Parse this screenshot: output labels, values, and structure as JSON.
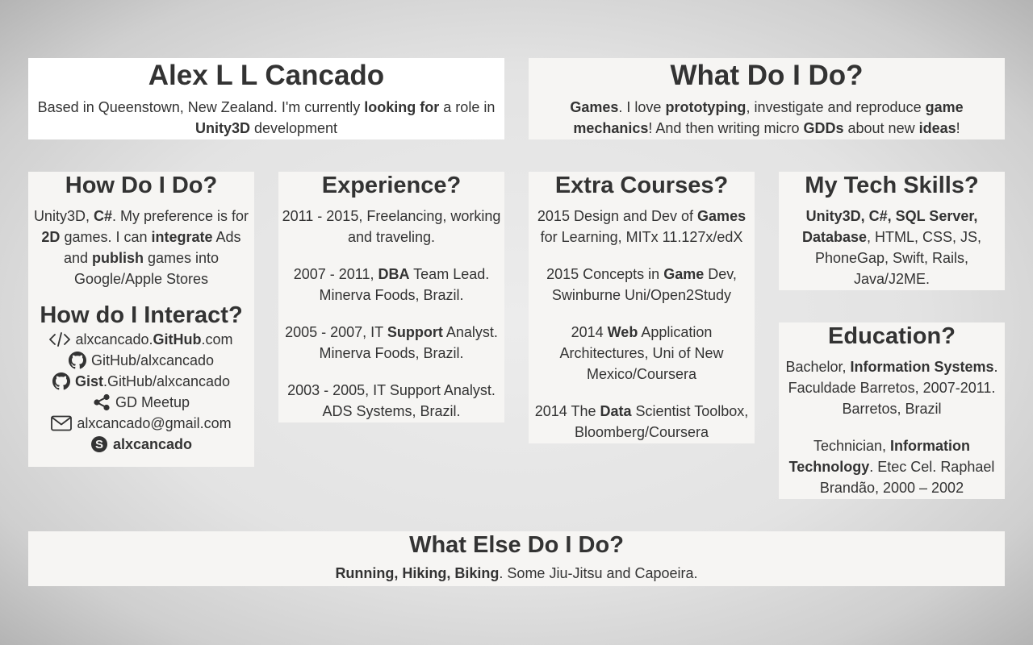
{
  "header": {
    "name": "Alex L L Cancado",
    "bio": [
      {
        "t": "Based in Queenstown, New Zealand. I'm currently "
      },
      {
        "t": "looking for",
        "b": true
      },
      {
        "t": " a role in "
      },
      {
        "t": "Unity3D",
        "b": true
      },
      {
        "t": " development"
      }
    ]
  },
  "what_do": {
    "title": "What Do I Do?",
    "text": [
      {
        "t": "Games",
        "b": true
      },
      {
        "t": ". I love "
      },
      {
        "t": "prototyping",
        "b": true
      },
      {
        "t": ", investigate and reproduce "
      },
      {
        "t": "game mechanics",
        "b": true
      },
      {
        "t": "! And then writing micro "
      },
      {
        "t": "GDDs",
        "b": true
      },
      {
        "t": " about new "
      },
      {
        "t": "ideas",
        "b": true
      },
      {
        "t": "!"
      }
    ]
  },
  "how_do": {
    "title": "How Do I Do?",
    "text": [
      {
        "t": "Unity3D, "
      },
      {
        "t": "C#",
        "b": true
      },
      {
        "t": ". My preference is for "
      },
      {
        "t": "2D",
        "b": true
      },
      {
        "t": " games. I can "
      },
      {
        "t": "integrate",
        "b": true
      },
      {
        "t": " Ads and "
      },
      {
        "t": "publish",
        "b": true
      },
      {
        "t": " games into Google/Apple Stores"
      }
    ]
  },
  "interact": {
    "title": "How do I Interact?",
    "contacts": [
      {
        "icon": "code-icon",
        "name": "contact-github-pages",
        "parts": [
          {
            "t": "alxcancado."
          },
          {
            "t": "GitHub",
            "b": true
          },
          {
            "t": ".com"
          }
        ]
      },
      {
        "icon": "github-icon",
        "name": "contact-github",
        "parts": [
          {
            "t": "GitHub/alxcancado"
          }
        ]
      },
      {
        "icon": "github-icon",
        "name": "contact-gist",
        "parts": [
          {
            "t": "Gist",
            "b": true
          },
          {
            "t": ".GitHub/alxcancado"
          }
        ]
      },
      {
        "icon": "share-icon",
        "name": "contact-gd-meetup",
        "parts": [
          {
            "t": "GD Meetup"
          }
        ]
      },
      {
        "icon": "envelope-icon",
        "name": "contact-email",
        "parts": [
          {
            "t": "alxcancado@gmail.com"
          }
        ]
      },
      {
        "icon": "skype-icon",
        "name": "contact-skype",
        "parts": [
          {
            "t": "alxcancado",
            "b": true
          }
        ]
      }
    ]
  },
  "experience": {
    "title": "Experience?",
    "items": [
      [
        {
          "t": "2011 - 2015, Freelancing, working and traveling."
        }
      ],
      [
        {
          "t": "2007 - 2011, "
        },
        {
          "t": "DBA",
          "b": true
        },
        {
          "t": " Team Lead. Minerva Foods, Brazil."
        }
      ],
      [
        {
          "t": "2005 - 2007, IT "
        },
        {
          "t": "Support",
          "b": true
        },
        {
          "t": " Analyst. Minerva Foods, Brazil."
        }
      ],
      [
        {
          "t": "2003 - 2005, IT Support Analyst. ADS Systems, Brazil."
        }
      ]
    ]
  },
  "courses": {
    "title": "Extra Courses?",
    "items": [
      [
        {
          "t": "2015 Design and Dev of "
        },
        {
          "t": "Games",
          "b": true
        },
        {
          "t": " for Learning, MITx 11.127x/edX"
        }
      ],
      [
        {
          "t": "2015 Concepts in "
        },
        {
          "t": "Game",
          "b": true
        },
        {
          "t": " Dev, Swinburne Uni/Open2Study"
        }
      ],
      [
        {
          "t": "2014 "
        },
        {
          "t": "Web",
          "b": true
        },
        {
          "t": " Application Architectures, Uni of New Mexico/Coursera"
        }
      ],
      [
        {
          "t": "2014 The "
        },
        {
          "t": "Data",
          "b": true
        },
        {
          "t": " Scientist Toolbox, Bloomberg/Coursera"
        }
      ]
    ]
  },
  "skills": {
    "title": "My Tech Skills?",
    "text": [
      {
        "t": "Unity3D, C#, SQL Server, Database",
        "b": true
      },
      {
        "t": ", HTML, CSS, JS, PhoneGap, Swift, Rails, Java/J2ME."
      }
    ]
  },
  "education": {
    "title": "Education?",
    "items": [
      [
        {
          "t": "Bachelor, "
        },
        {
          "t": "Information Systems",
          "b": true
        },
        {
          "t": ". Faculdade Barretos, 2007-2011. Barretos, Brazil"
        }
      ],
      [
        {
          "t": "Technician, "
        },
        {
          "t": "Information Technology",
          "b": true
        },
        {
          "t": ". Etec Cel. Raphael Brandão, 2000 – 2002"
        }
      ]
    ]
  },
  "what_else": {
    "title": "What Else Do I Do?",
    "text": [
      {
        "t": "Running, Hiking, Biking",
        "b": true
      },
      {
        "t": ". Some Jiu-Jitsu and Capoeira."
      }
    ]
  }
}
